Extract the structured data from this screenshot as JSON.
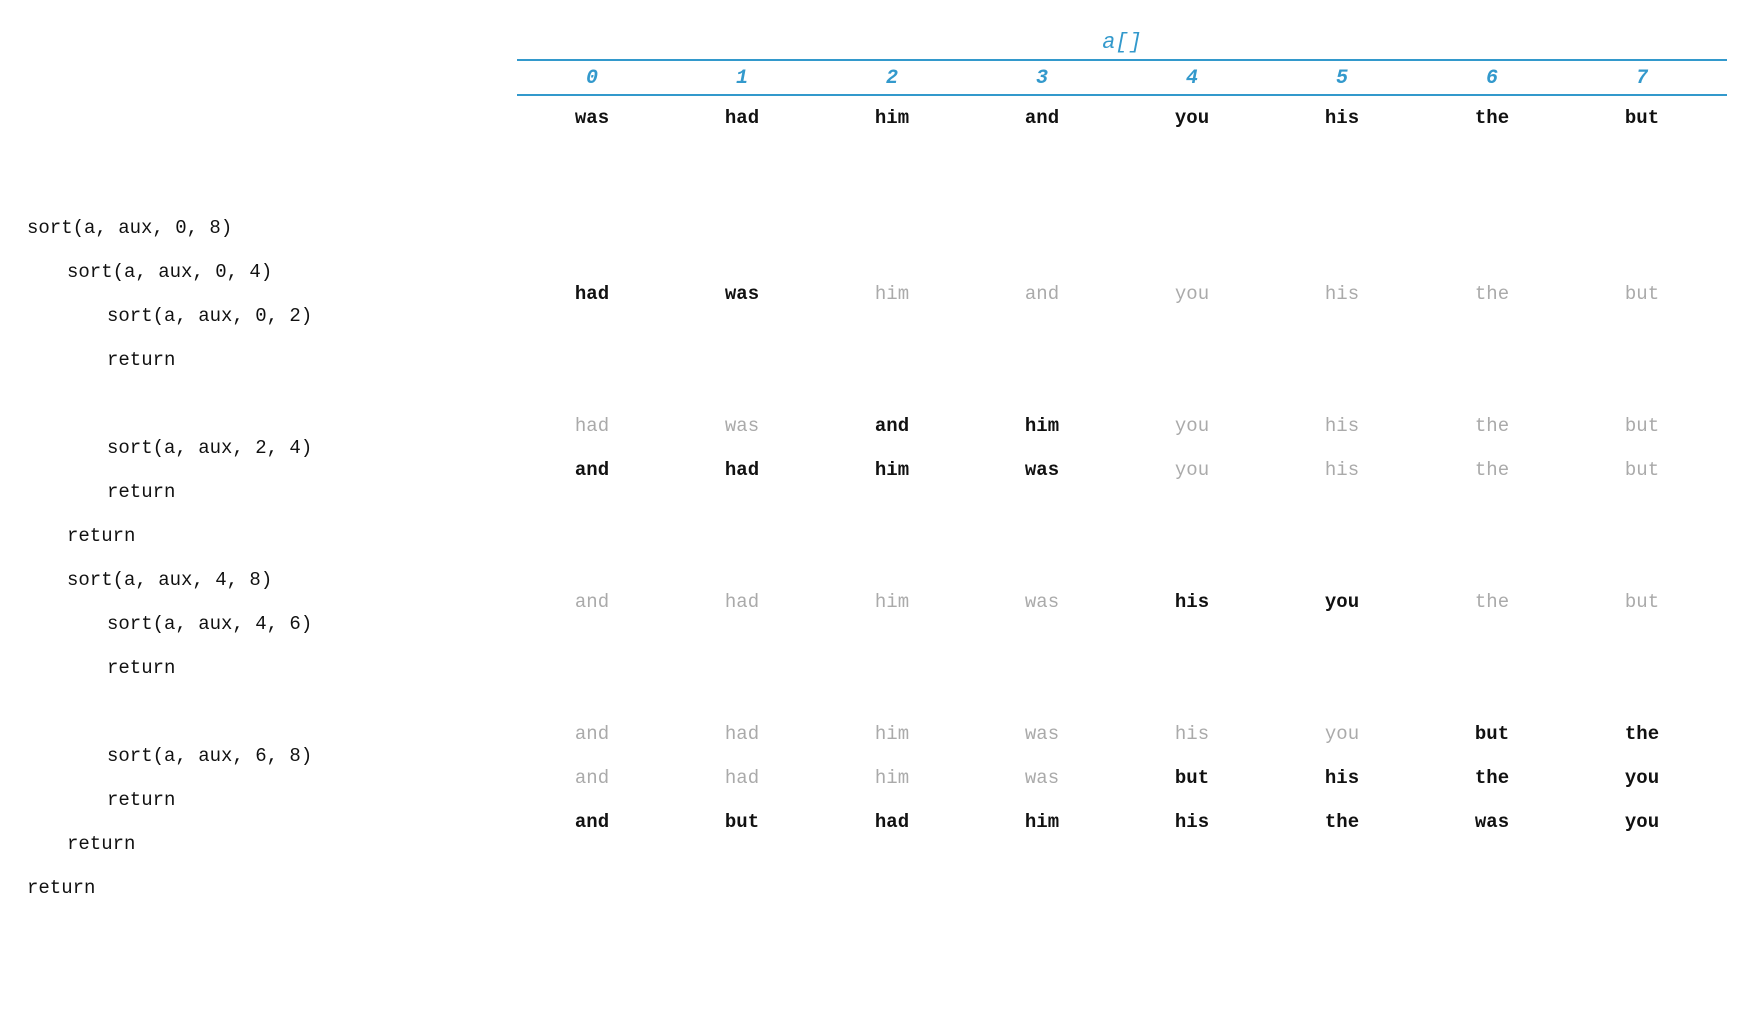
{
  "array": {
    "title": "a[]",
    "indices": [
      "0",
      "1",
      "2",
      "3",
      "4",
      "5",
      "6",
      "7"
    ]
  },
  "rows": [
    {
      "left": {
        "text": "",
        "indent": 0
      },
      "right": [
        {
          "text": "was",
          "style": "bold"
        },
        {
          "text": "had",
          "style": "bold"
        },
        {
          "text": "him",
          "style": "bold"
        },
        {
          "text": "and",
          "style": "bold"
        },
        {
          "text": "you",
          "style": "bold"
        },
        {
          "text": "his",
          "style": "bold"
        },
        {
          "text": "the",
          "style": "bold"
        },
        {
          "text": "but",
          "style": "bold"
        }
      ]
    },
    {
      "left": {
        "text": "sort(a, aux, 0, 8)",
        "indent": 0
      },
      "right": []
    },
    {
      "left": {
        "text": "sort(a, aux, 0, 4)",
        "indent": 1
      },
      "right": []
    },
    {
      "left": {
        "text": "sort(a, aux, 0, 2)",
        "indent": 2
      },
      "right": []
    },
    {
      "left": {
        "text": "return",
        "indent": 2
      },
      "right": [
        {
          "text": "had",
          "style": "bold"
        },
        {
          "text": "was",
          "style": "bold"
        },
        {
          "text": "him",
          "style": "faded"
        },
        {
          "text": "and",
          "style": "faded"
        },
        {
          "text": "you",
          "style": "faded"
        },
        {
          "text": "his",
          "style": "faded"
        },
        {
          "text": "the",
          "style": "faded"
        },
        {
          "text": "but",
          "style": "faded"
        }
      ]
    },
    {
      "left": {
        "text": "",
        "indent": 0
      },
      "right": []
    },
    {
      "left": {
        "text": "sort(a, aux, 2, 4)",
        "indent": 2
      },
      "right": []
    },
    {
      "left": {
        "text": "return",
        "indent": 2
      },
      "right": [
        {
          "text": "had",
          "style": "faded"
        },
        {
          "text": "was",
          "style": "faded"
        },
        {
          "text": "and",
          "style": "bold"
        },
        {
          "text": "him",
          "style": "bold"
        },
        {
          "text": "you",
          "style": "faded"
        },
        {
          "text": "his",
          "style": "faded"
        },
        {
          "text": "the",
          "style": "faded"
        },
        {
          "text": "but",
          "style": "faded"
        }
      ]
    },
    {
      "left": {
        "text": "return",
        "indent": 1
      },
      "right": [
        {
          "text": "and",
          "style": "bold"
        },
        {
          "text": "had",
          "style": "bold"
        },
        {
          "text": "him",
          "style": "bold"
        },
        {
          "text": "was",
          "style": "bold"
        },
        {
          "text": "you",
          "style": "faded"
        },
        {
          "text": "his",
          "style": "faded"
        },
        {
          "text": "the",
          "style": "faded"
        },
        {
          "text": "but",
          "style": "faded"
        }
      ]
    },
    {
      "left": {
        "text": "sort(a, aux, 4, 8)",
        "indent": 1
      },
      "right": []
    },
    {
      "left": {
        "text": "sort(a, aux, 4, 6)",
        "indent": 2
      },
      "right": []
    },
    {
      "left": {
        "text": "return",
        "indent": 2
      },
      "right": [
        {
          "text": "and",
          "style": "faded"
        },
        {
          "text": "had",
          "style": "faded"
        },
        {
          "text": "him",
          "style": "faded"
        },
        {
          "text": "was",
          "style": "faded"
        },
        {
          "text": "his",
          "style": "bold"
        },
        {
          "text": "you",
          "style": "bold"
        },
        {
          "text": "the",
          "style": "faded"
        },
        {
          "text": "but",
          "style": "faded"
        }
      ]
    },
    {
      "left": {
        "text": "",
        "indent": 0
      },
      "right": []
    },
    {
      "left": {
        "text": "sort(a, aux, 6, 8)",
        "indent": 2
      },
      "right": []
    },
    {
      "left": {
        "text": "return",
        "indent": 2
      },
      "right": [
        {
          "text": "and",
          "style": "faded"
        },
        {
          "text": "had",
          "style": "faded"
        },
        {
          "text": "him",
          "style": "faded"
        },
        {
          "text": "was",
          "style": "faded"
        },
        {
          "text": "his",
          "style": "faded"
        },
        {
          "text": "you",
          "style": "faded"
        },
        {
          "text": "but",
          "style": "bold"
        },
        {
          "text": "the",
          "style": "bold"
        }
      ]
    },
    {
      "left": {
        "text": "return",
        "indent": 1
      },
      "right": [
        {
          "text": "and",
          "style": "faded"
        },
        {
          "text": "had",
          "style": "faded"
        },
        {
          "text": "him",
          "style": "faded"
        },
        {
          "text": "was",
          "style": "faded"
        },
        {
          "text": "but",
          "style": "bold"
        },
        {
          "text": "his",
          "style": "bold"
        },
        {
          "text": "the",
          "style": "bold"
        },
        {
          "text": "you",
          "style": "bold"
        }
      ]
    },
    {
      "left": {
        "text": "return",
        "indent": 0
      },
      "right": [
        {
          "text": "and",
          "style": "bold"
        },
        {
          "text": "but",
          "style": "bold"
        },
        {
          "text": "had",
          "style": "bold"
        },
        {
          "text": "him",
          "style": "bold"
        },
        {
          "text": "his",
          "style": "bold"
        },
        {
          "text": "the",
          "style": "bold"
        },
        {
          "text": "was",
          "style": "bold"
        },
        {
          "text": "you",
          "style": "bold"
        }
      ]
    }
  ]
}
